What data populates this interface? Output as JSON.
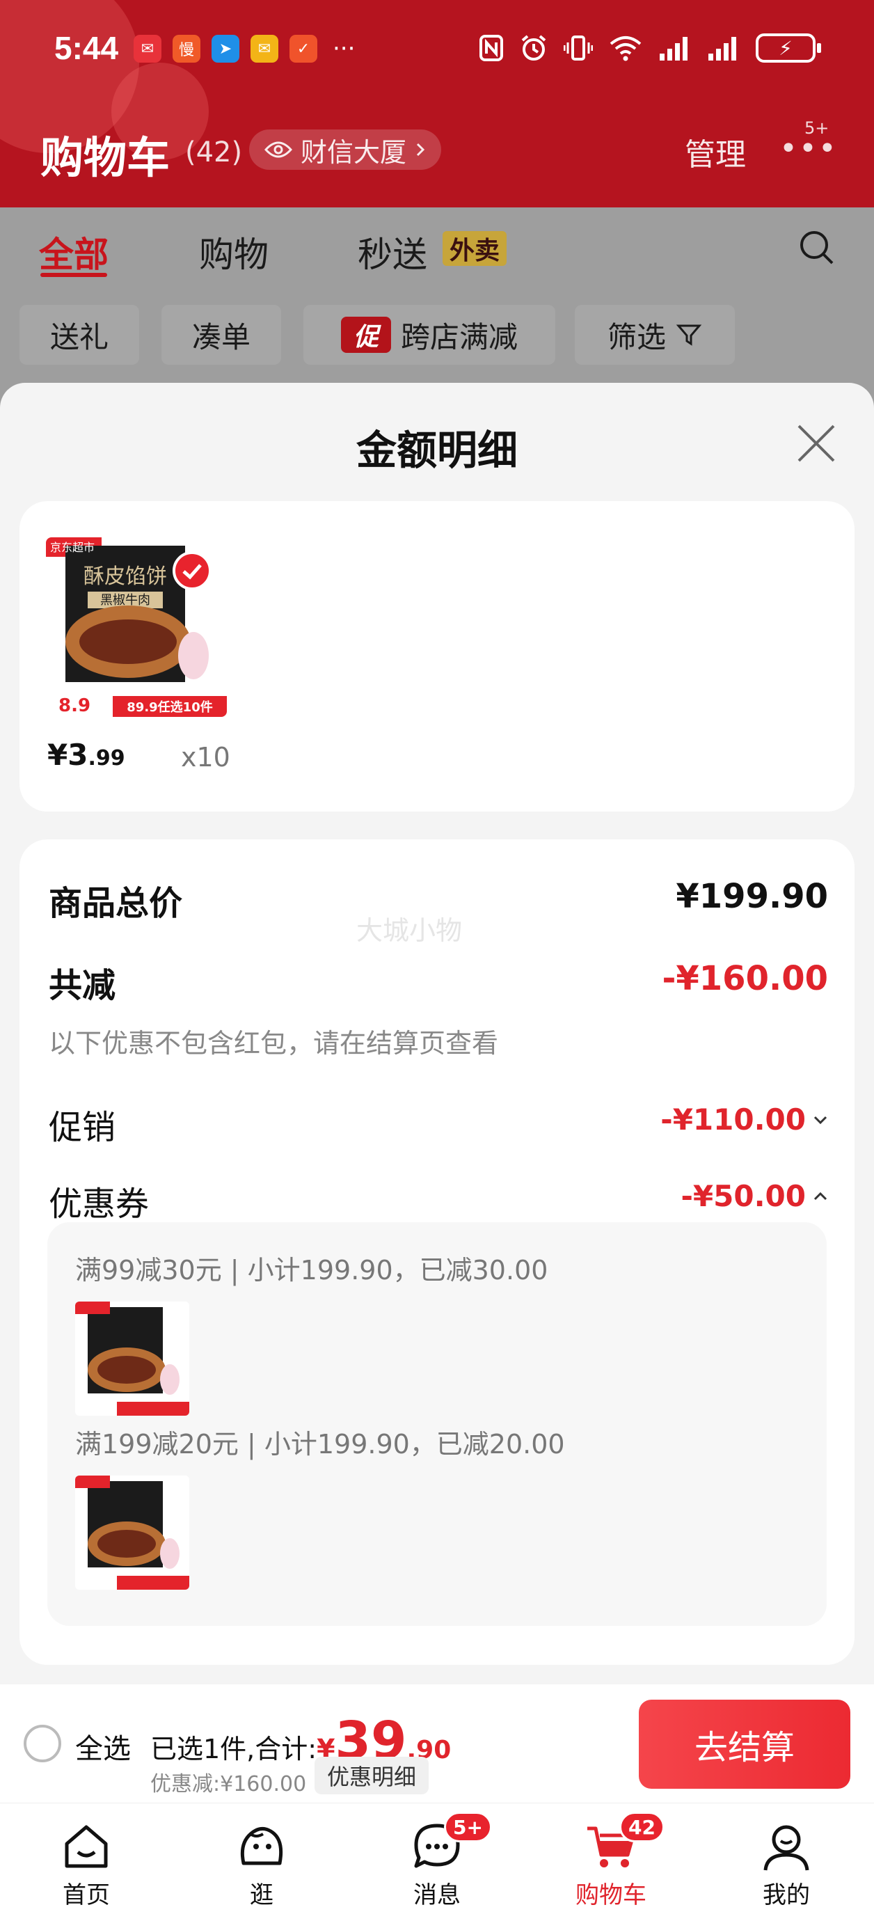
{
  "status_bar": {
    "time": "5:44",
    "app_icons": [
      {
        "name": "mail-app-icon",
        "color": "#e8323a",
        "glyph": "✉"
      },
      {
        "name": "video-app-icon",
        "color": "#f05a28",
        "glyph": "慢"
      },
      {
        "name": "map-app-icon",
        "color": "#1f8fe8",
        "glyph": "➤"
      },
      {
        "name": "message-app-icon",
        "color": "#f3b417",
        "glyph": "✉"
      },
      {
        "name": "shop-app-icon",
        "color": "#f0532b",
        "glyph": "✓"
      }
    ],
    "more": "···",
    "battery_glyph": "⚡"
  },
  "header": {
    "title": "购物车",
    "count": "(42)",
    "address": "财信大厦",
    "manage": "管理",
    "more_badge": "5+",
    "brand_color": "#b5141f"
  },
  "tabs": [
    {
      "label": "全部",
      "active": true
    },
    {
      "label": "购物",
      "active": false
    },
    {
      "label": "秒送",
      "active": false
    }
  ],
  "takeout_badge": "外卖",
  "chips": {
    "gift": "送礼",
    "bundle": "凑单",
    "promo_icon": "促",
    "cross_store": "跨店满减",
    "filter": "筛选"
  },
  "sheet": {
    "title": "金额明细",
    "product": {
      "price_int": "¥3",
      "price_dec": ".99",
      "quantity": "x10",
      "image_labels": {
        "brand": "京东超市",
        "name": "酥皮馅饼",
        "flavor": "黑椒牛肉",
        "price_tag": "8.9",
        "promo": "89.9任选10件"
      }
    },
    "breakdown": {
      "watermark": "大城小物",
      "total_label": "商品总价",
      "total_value": "¥199.90",
      "reduce_label": "共减",
      "reduce_value": "-¥160.00",
      "reduce_note": "以下优惠不包含红包，请在结算页查看",
      "promo_label": "促销",
      "promo_value": "-¥110.00",
      "coupon_label": "优惠券",
      "coupon_value": "-¥50.00",
      "coupons": [
        {
          "text": "满99减30元 | 小计199.90，已减30.00"
        },
        {
          "text": "满199减20元 | 小计199.90，已减20.00"
        }
      ]
    }
  },
  "checkout": {
    "select_all": "全选",
    "selected_prefix": "已选1件,合计:",
    "total_yen": "¥",
    "total_int": "39",
    "total_dec": ".90",
    "discount": "优惠减:¥160.00",
    "discount_detail": "优惠明细",
    "button": "去结算",
    "accent": "#e0242c"
  },
  "bottom_nav": [
    {
      "label": "首页",
      "icon": "home-icon",
      "active": false
    },
    {
      "label": "逛",
      "icon": "browse-icon",
      "active": false
    },
    {
      "label": "消息",
      "icon": "message-icon",
      "active": false,
      "badge": "5+"
    },
    {
      "label": "购物车",
      "icon": "cart-icon",
      "active": true,
      "badge": "42"
    },
    {
      "label": "我的",
      "icon": "profile-icon",
      "active": false
    }
  ]
}
